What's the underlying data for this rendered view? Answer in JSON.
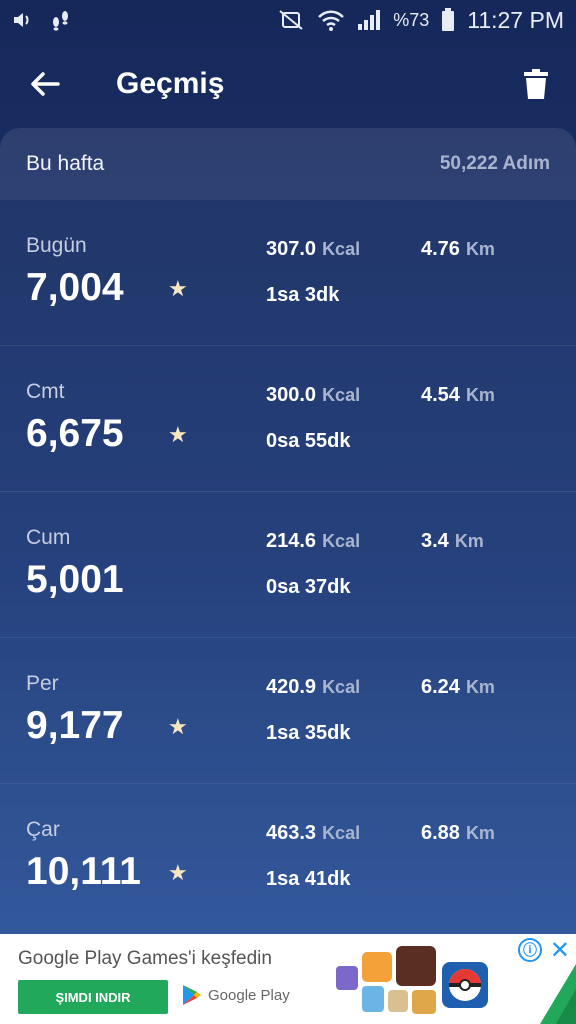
{
  "status_bar": {
    "battery": "%73",
    "time": "11:27 PM",
    "icons": [
      "volume-icon",
      "steps-icon",
      "mute-icon",
      "wifi-icon",
      "signal-icon",
      "battery-icon"
    ]
  },
  "app_bar": {
    "title": "Geçmiş",
    "back_icon": "back-arrow-icon",
    "delete_icon": "trash-icon"
  },
  "week": {
    "label": "Bu hafta",
    "total": "50,222 Adım"
  },
  "units": {
    "kcal": "Kcal",
    "km": "Km"
  },
  "days": [
    {
      "name": "Bugün",
      "steps": "7,004",
      "star": "★",
      "kcal": "307.0",
      "km": "4.76",
      "duration": "1sa 3dk"
    },
    {
      "name": "Cmt",
      "steps": "6,675",
      "star": "★",
      "kcal": "300.0",
      "km": "4.54",
      "duration": "0sa 55dk"
    },
    {
      "name": "Cum",
      "steps": "5,001",
      "star": "",
      "kcal": "214.6",
      "km": "3.4",
      "duration": "0sa 37dk"
    },
    {
      "name": "Per",
      "steps": "9,177",
      "star": "★",
      "kcal": "420.9",
      "km": "6.24",
      "duration": "1sa 35dk"
    },
    {
      "name": "Çar",
      "steps": "10,111",
      "star": "★",
      "kcal": "463.3",
      "km": "6.88",
      "duration": "1sa 41dk"
    }
  ],
  "ad": {
    "headline": "Google Play Games'i keşfedin",
    "cta": "ŞIMDI INDIR",
    "store": "Google Play",
    "info_icon": "ⓘ",
    "close_icon": "✕"
  },
  "colors": {
    "bg_top": "#16285a",
    "bg_bottom": "#2e58a0",
    "unit_gray": "#a9b5cf",
    "star": "#f6e7c1",
    "cta_green": "#21a85a",
    "ad_blue": "#2196f3"
  }
}
